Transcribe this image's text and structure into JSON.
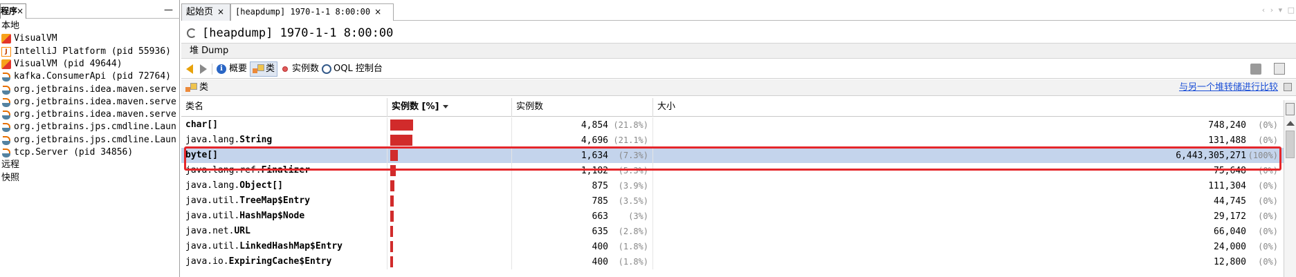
{
  "left_panel": {
    "tab_label": "程序",
    "close": "×",
    "minimize": "—",
    "items": [
      {
        "label": "本地",
        "icon": "none"
      },
      {
        "label": "VisualVM",
        "icon": "visualvm-icon"
      },
      {
        "label": "IntelliJ Platform (pid 55936)",
        "icon": "intellij-icon"
      },
      {
        "label": "VisualVM (pid 49644)",
        "icon": "visualvm-icon"
      },
      {
        "label": "kafka.ConsumerApi (pid 72764)",
        "icon": "java-icon"
      },
      {
        "label": "org.jetbrains.idea.maven.serve",
        "icon": "java-icon"
      },
      {
        "label": "org.jetbrains.idea.maven.serve",
        "icon": "java-icon"
      },
      {
        "label": "org.jetbrains.idea.maven.serve",
        "icon": "java-icon"
      },
      {
        "label": "org.jetbrains.jps.cmdline.Laun",
        "icon": "java-icon"
      },
      {
        "label": "org.jetbrains.jps.cmdline.Laun",
        "icon": "java-icon"
      },
      {
        "label": "tcp.Server (pid 34856)",
        "icon": "java-icon"
      },
      {
        "label": "远程",
        "icon": "none"
      },
      {
        "label": "快照",
        "icon": "none"
      }
    ]
  },
  "tabs": [
    {
      "label": "起始页",
      "close": "×",
      "active": false
    },
    {
      "label": "[heapdump] 1970-1-1 8:00:00",
      "close": "×",
      "active": true
    }
  ],
  "tab_nav": "‹ › ▾ □",
  "title": "[heapdump] 1970-1-1 8:00:00",
  "dump_bar": "堆 Dump",
  "toolbar": {
    "overview": "概要",
    "classes": "类",
    "instances": "实例数",
    "oql": "OQL 控制台"
  },
  "classes_header": {
    "label": "类",
    "compare_link": "与另一个堆转储进行比较"
  },
  "table": {
    "columns": [
      "类名",
      "实例数 [%]",
      "实例数",
      "大小"
    ],
    "rows": [
      {
        "pre": "",
        "name": "char[]",
        "bar": 21.8,
        "count": "4,854",
        "count_pct": "(21.8%)",
        "size": "748,240",
        "size_pct": "(0%)",
        "selected": false
      },
      {
        "pre": "java.lang.",
        "name": "String",
        "bar": 21.1,
        "count": "4,696",
        "count_pct": "(21.1%)",
        "size": "131,488",
        "size_pct": "(0%)",
        "selected": false
      },
      {
        "pre": "",
        "name": "byte[]",
        "bar": 7.3,
        "count": "1,634",
        "count_pct": "(7.3%)",
        "size": "6,443,305,271",
        "size_pct": "(100%)",
        "selected": true
      },
      {
        "pre": "java.lang.ref.",
        "name": "Finalizer",
        "bar": 5.3,
        "count": "1,182",
        "count_pct": "(5.3%)",
        "size": "75,648",
        "size_pct": "(0%)",
        "selected": false
      },
      {
        "pre": "java.lang.",
        "name": "Object[]",
        "bar": 3.9,
        "count": "875",
        "count_pct": "(3.9%)",
        "size": "111,304",
        "size_pct": "(0%)",
        "selected": false
      },
      {
        "pre": "java.util.",
        "name": "TreeMap$Entry",
        "bar": 3.5,
        "count": "785",
        "count_pct": "(3.5%)",
        "size": "44,745",
        "size_pct": "(0%)",
        "selected": false
      },
      {
        "pre": "java.util.",
        "name": "HashMap$Node",
        "bar": 3.0,
        "count": "663",
        "count_pct": "(3%)",
        "size": "29,172",
        "size_pct": "(0%)",
        "selected": false
      },
      {
        "pre": "java.net.",
        "name": "URL",
        "bar": 2.8,
        "count": "635",
        "count_pct": "(2.8%)",
        "size": "66,040",
        "size_pct": "(0%)",
        "selected": false
      },
      {
        "pre": "java.util.",
        "name": "LinkedHashMap$Entry",
        "bar": 1.8,
        "count": "400",
        "count_pct": "(1.8%)",
        "size": "24,000",
        "size_pct": "(0%)",
        "selected": false
      },
      {
        "pre": "java.io.",
        "name": "ExpiringCache$Entry",
        "bar": 1.8,
        "count": "400",
        "count_pct": "(1.8%)",
        "size": "12,800",
        "size_pct": "(0%)",
        "selected": false
      }
    ]
  },
  "colors": {
    "bar": "#d12b2b",
    "selection": "#c4d4ec",
    "highlight": "#e5262a",
    "link": "#1b4fd6"
  }
}
